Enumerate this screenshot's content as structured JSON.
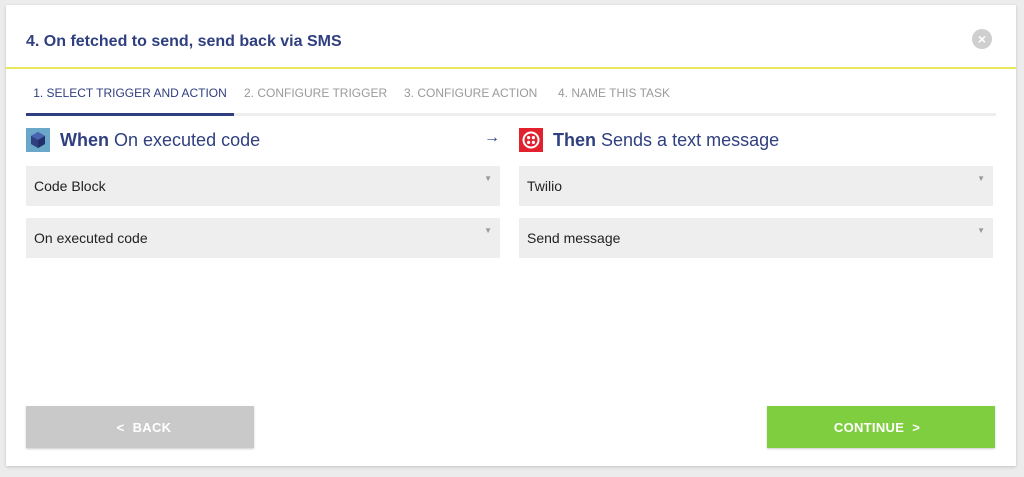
{
  "modal": {
    "title": "4. On fetched to send, send back via SMS",
    "close_symbol": "×"
  },
  "tabs": [
    {
      "label": "1. SELECT TRIGGER AND ACTION",
      "active": true
    },
    {
      "label": "2. CONFIGURE TRIGGER",
      "active": false
    },
    {
      "label": "3. CONFIGURE ACTION",
      "active": false
    },
    {
      "label": "4. NAME THIS TASK",
      "active": false
    }
  ],
  "trigger": {
    "keyword": "When",
    "description": "On executed code",
    "icon": "code-block-icon",
    "app_select": "Code Block",
    "event_select": "On executed code"
  },
  "arrow_symbol": "→",
  "action": {
    "keyword": "Then",
    "description": "Sends a text message",
    "icon": "twilio-icon",
    "app_select": "Twilio",
    "event_select": "Send message"
  },
  "buttons": {
    "back_label": "BACK",
    "back_chevron": "<",
    "continue_label": "CONTINUE",
    "continue_chevron": ">"
  },
  "colors": {
    "title": "#2f3f7f",
    "accent_line": "#e6e85a",
    "continue": "#7fce3f",
    "back": "#c9c9c9",
    "twilio": "#e3202e",
    "code_block": "#6aa7c8"
  }
}
